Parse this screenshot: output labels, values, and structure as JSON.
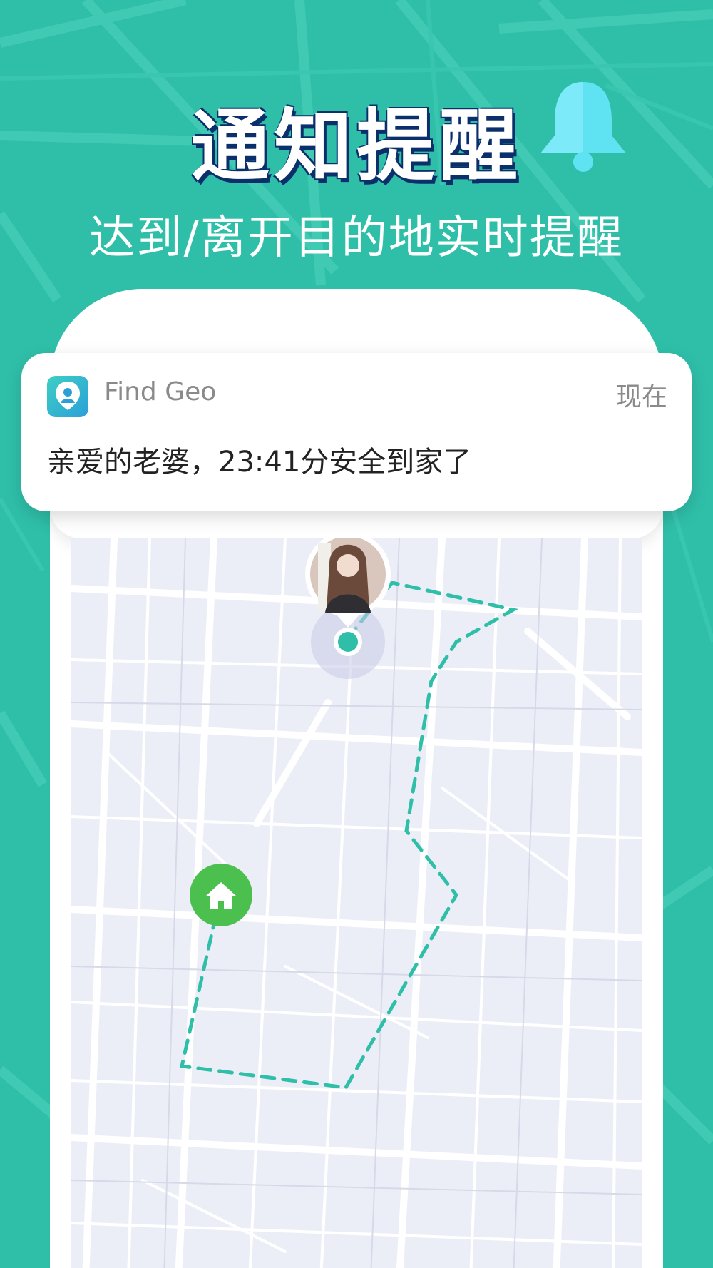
{
  "header": {
    "title": "通知提醒",
    "subtitle": "达到/离开目的地实时提醒"
  },
  "notification": {
    "app_name": "Find Geo",
    "time": "现在",
    "message": "亲爱的老婆，23:41分安全到家了"
  },
  "icons": {
    "bell": "bell-icon",
    "app": "map-pin-person-icon",
    "home": "home-icon",
    "avatar": "user-avatar",
    "location": "location-dot-icon"
  },
  "colors": {
    "background": "#2fbfa9",
    "title_shadow": "#0b2f6b",
    "route": "#2fbfa9",
    "home_marker": "#4cc04f",
    "bell": "#5fe3f3"
  }
}
